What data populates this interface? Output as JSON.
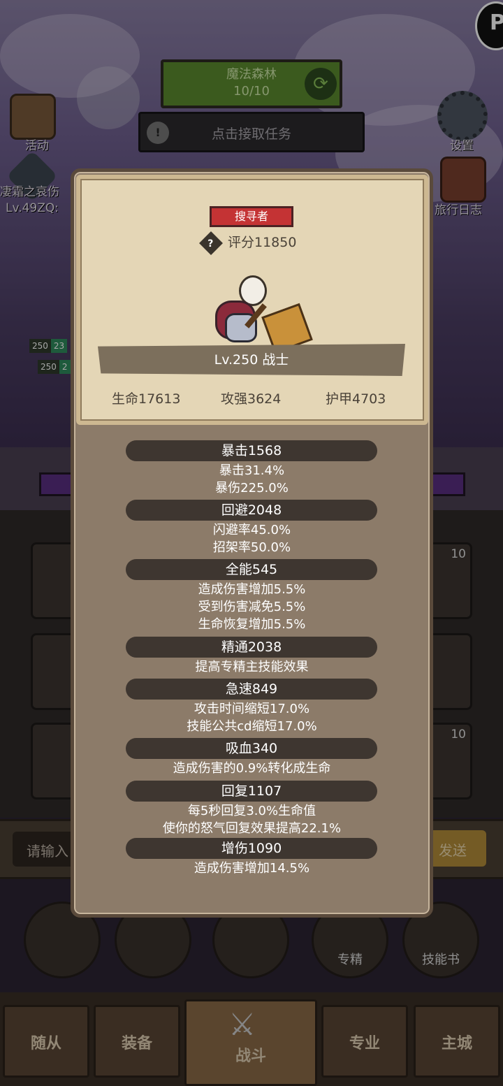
{
  "header": {
    "stage_name": "魔法森林",
    "stage_progress": "10/10",
    "task_prompt": "点击接取任务",
    "corner_badge": "P"
  },
  "side_left": {
    "activity_label": "活动",
    "boss_label": "凄霜之哀伤",
    "boss_sub": "Lv.49ZQ:"
  },
  "side_right": {
    "settings_label": "设置",
    "journal_label": "旅行日志"
  },
  "party_badges": [
    {
      "level": "250",
      "value": "23"
    },
    {
      "level": "250",
      "value": "2"
    }
  ],
  "inventory": {
    "counts": [
      "10",
      "10"
    ]
  },
  "chat": {
    "placeholder": "请输入",
    "send_label": "发送"
  },
  "actions": {
    "specialize_label": "专精",
    "skillbook_label": "技能书"
  },
  "nav": {
    "tabs": [
      "随从",
      "装备",
      "战斗",
      "专业",
      "主城"
    ]
  },
  "modal": {
    "title_tag": "搜寻者",
    "score": "评分11850",
    "level_class": "Lv.250 战士",
    "hp": "生命17613",
    "attack": "攻强3624",
    "armor": "护甲4703",
    "stats": [
      {
        "name": "暴击1568",
        "lines": [
          "暴击31.4%",
          "暴伤225.0%"
        ]
      },
      {
        "name": "回避2048",
        "lines": [
          "闪避率45.0%",
          "招架率50.0%"
        ]
      },
      {
        "name": "全能545",
        "lines": [
          "造成伤害增加5.5%",
          "受到伤害减免5.5%",
          "生命恢复增加5.5%"
        ]
      },
      {
        "name": "精通2038",
        "lines": [
          "提高专精主技能效果"
        ]
      },
      {
        "name": "急速849",
        "lines": [
          "攻击时间缩短17.0%",
          "技能公共cd缩短17.0%"
        ]
      },
      {
        "name": "吸血340",
        "lines": [
          "造成伤害的0.9%转化成生命"
        ]
      },
      {
        "name": "回复1107",
        "lines": [
          "每5秒回复3.0%生命值",
          "使你的怒气回复效果提高22.1%"
        ]
      },
      {
        "name": "增伤1090",
        "lines": [
          "造成伤害增加14.5%"
        ]
      }
    ]
  }
}
